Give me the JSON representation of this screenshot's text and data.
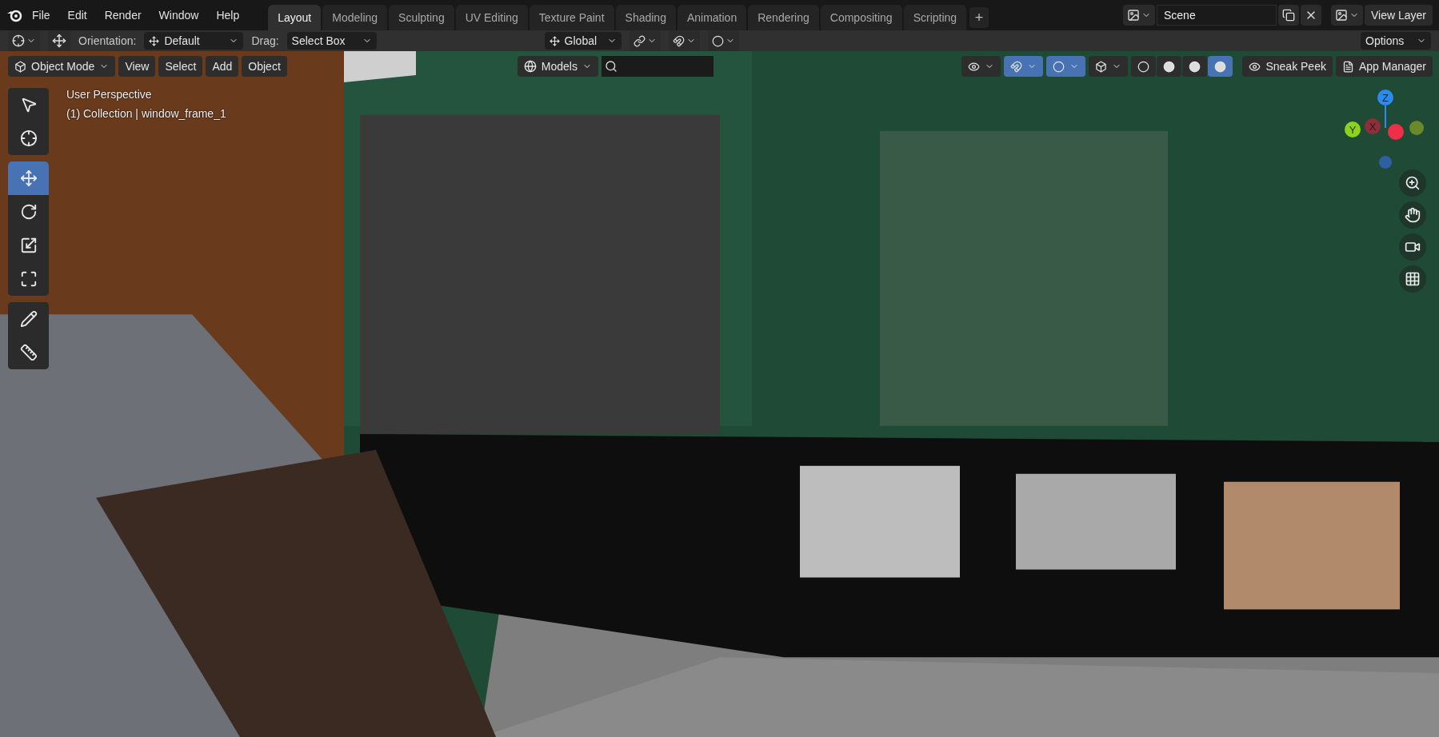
{
  "menu": [
    "File",
    "Edit",
    "Render",
    "Window",
    "Help"
  ],
  "workspaces": [
    {
      "label": "Layout",
      "selected": true
    },
    {
      "label": "Modeling",
      "selected": false
    },
    {
      "label": "Sculpting",
      "selected": false
    },
    {
      "label": "UV Editing",
      "selected": false
    },
    {
      "label": "Texture Paint",
      "selected": false
    },
    {
      "label": "Shading",
      "selected": false
    },
    {
      "label": "Animation",
      "selected": false
    },
    {
      "label": "Rendering",
      "selected": false
    },
    {
      "label": "Compositing",
      "selected": false
    },
    {
      "label": "Scripting",
      "selected": false
    }
  ],
  "add_workspace": "+",
  "scene": {
    "name": "Scene"
  },
  "view_layer": {
    "name": "View Layer"
  },
  "tool_settings": {
    "orientation_label": "Orientation:",
    "orientation": "Default",
    "drag_label": "Drag:",
    "drag": "Select Box",
    "transform_orientation": "Global",
    "options": "Options"
  },
  "viewport_header": {
    "mode": "Object Mode",
    "menus": [
      "View",
      "Select",
      "Add",
      "Object"
    ],
    "asset_library": "Models",
    "toggles": [
      {
        "on": false
      },
      {
        "on": true
      },
      {
        "on": true
      },
      {
        "on": false
      }
    ],
    "shading": [
      {
        "selected": false
      },
      {
        "selected": false
      },
      {
        "selected": false
      },
      {
        "selected": true
      }
    ],
    "buttons": [
      "Sneak Peek",
      "App Manager"
    ]
  },
  "toolbar": [
    [
      {
        "selected": false
      },
      {
        "selected": false
      }
    ],
    [
      {
        "selected": true
      },
      {
        "selected": false
      },
      {
        "selected": false
      },
      {
        "selected": false
      }
    ],
    [
      {
        "selected": false
      },
      {
        "selected": false
      }
    ]
  ],
  "overlay_text": [
    "User Perspective",
    "(1) Collection | window_frame_1"
  ],
  "gizmo": {
    "z": "Z",
    "y": "Y",
    "x": "X"
  },
  "viewport": {
    "kind": "picture"
  }
}
